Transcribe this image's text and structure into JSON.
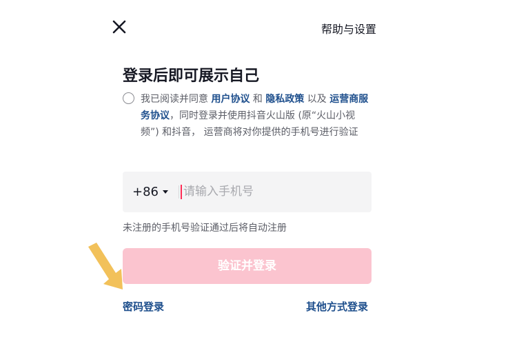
{
  "header": {
    "close_glyph": "×",
    "help_label": "帮助与设置"
  },
  "title": "登录后即可展示自己",
  "agreement": {
    "p1": "我已阅读并同意 ",
    "user_agreement": "用户协议",
    "and": " 和 ",
    "privacy_policy": "隐私政策",
    "and2": " 以及 ",
    "operator_agreement": "运营商服务协议",
    "p2": "，同时登录并使用抖音火山版 (原“火山小视频”) 和抖音， 运营商将对你提供的手机号进行验证"
  },
  "phone": {
    "country_code": "+86",
    "placeholder": "请输入手机号",
    "value": ""
  },
  "hint": "未注册的手机号验证通过后将自动注册",
  "login_button": "验证并登录",
  "password_login": "密码登录",
  "other_login": "其他方式登录",
  "colors": {
    "accent": "#fe2c55",
    "button_disabled": "#fbc4cf",
    "link": "#1d4e8c",
    "annotation_arrow": "#f2c15a"
  },
  "icons": {
    "close": "close-icon",
    "dropdown": "chevron-down-icon",
    "annotation": "arrow-pointer-icon"
  }
}
